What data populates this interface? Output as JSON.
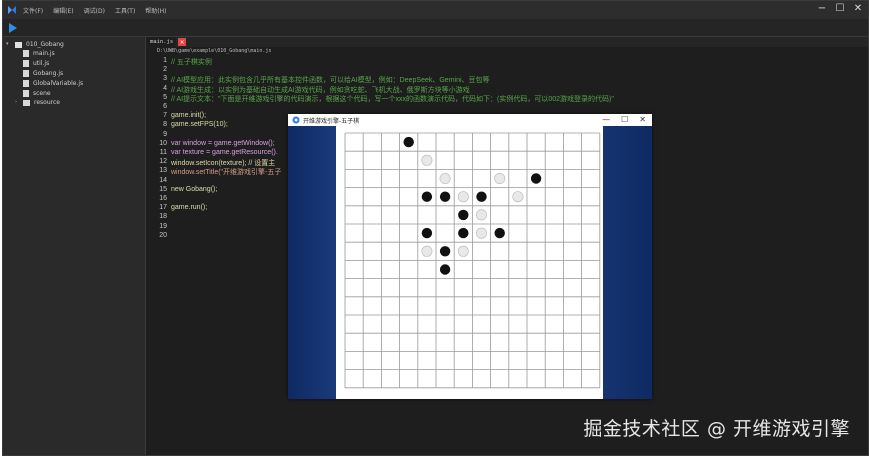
{
  "menu": [
    "文件(F)",
    "编辑(E)",
    "调试(D)",
    "工具(T)",
    "帮助(H)"
  ],
  "window_controls": {
    "minimize": "−",
    "maximize": "☐",
    "close": "✕"
  },
  "explorer": {
    "root": "010_Gobang",
    "items": [
      "main.js",
      "util.js",
      "Gobang.js",
      "GlobalVariable.js",
      "scene",
      "resource"
    ]
  },
  "editor": {
    "tab": "main.js",
    "tab_close": "×",
    "path": "D:\\UWB\\game\\example\\010_Gobang\\main.js",
    "lines": [
      {
        "n": "1",
        "text": "// 五子棋实例",
        "cls": "cmt"
      },
      {
        "n": "2",
        "text": "",
        "cls": "cmt"
      },
      {
        "n": "3",
        "text": "// AI模型应用：此实例包含几乎所有基本控件函数，可以给AI模型，例如：DeepSeek、Gemini、豆包等",
        "cls": "cmt"
      },
      {
        "n": "4",
        "text": "// AI游戏生成：以实例为基础自动生成AI游戏代码，例如贪吃蛇、飞机大战、俄罗斯方块等小游戏",
        "cls": "cmt"
      },
      {
        "n": "5",
        "text": "// AI提示文本：\"下面是开维游戏引擎的代码演示，根据这个代码，写一个xxx的函数演示代码，代码如下：(实例代码，可以002游戏登录的代码)\"",
        "cls": "cmt"
      },
      {
        "n": "6",
        "text": "",
        "cls": "plain"
      },
      {
        "n": "7",
        "text": "game.init();",
        "cls": "fn"
      },
      {
        "n": "8",
        "text": "game.setFPS(10);",
        "cls": "fn"
      },
      {
        "n": "9",
        "text": "",
        "cls": "plain"
      },
      {
        "n": "10",
        "text": "var window = game.getWindow();",
        "cls": "kw"
      },
      {
        "n": "11",
        "text": "var texture = game.getResource().",
        "cls": "kw"
      },
      {
        "n": "12",
        "text": "window.setIcon(texture); // 设置主",
        "cls": "fn"
      },
      {
        "n": "13",
        "text": "window.setTitle(\"开维游戏引擎-五子",
        "cls": "str"
      },
      {
        "n": "14",
        "text": "",
        "cls": "plain"
      },
      {
        "n": "15",
        "text": "new Gobang();",
        "cls": "fn"
      },
      {
        "n": "16",
        "text": "",
        "cls": "plain"
      },
      {
        "n": "17",
        "text": "game.run();",
        "cls": "fn"
      },
      {
        "n": "18",
        "text": "",
        "cls": "plain"
      },
      {
        "n": "19",
        "text": "",
        "cls": "plain"
      },
      {
        "n": "20",
        "text": "",
        "cls": "plain"
      }
    ]
  },
  "game_window": {
    "title": "开维游戏引擎-五子棋",
    "controls": {
      "minimize": "—",
      "maximize": "☐",
      "close": "✕"
    },
    "board": {
      "grid_lines": 15,
      "stones": [
        {
          "col": 4,
          "row": 7,
          "color": "black"
        },
        {
          "col": 5,
          "row": 8,
          "color": "white"
        },
        {
          "col": 6,
          "row": 9,
          "color": "white"
        },
        {
          "col": 9,
          "row": 9,
          "color": "white"
        },
        {
          "col": 11,
          "row": 9,
          "color": "black"
        },
        {
          "col": 5,
          "row": 10,
          "color": "black"
        },
        {
          "col": 6,
          "row": 10,
          "color": "black"
        },
        {
          "col": 7,
          "row": 10,
          "color": "white"
        },
        {
          "col": 8,
          "row": 10,
          "color": "black"
        },
        {
          "col": 10,
          "row": 10,
          "color": "white"
        },
        {
          "col": 7,
          "row": 11,
          "color": "black"
        },
        {
          "col": 8,
          "row": 11,
          "color": "white"
        },
        {
          "col": 5,
          "row": 12,
          "color": "black"
        },
        {
          "col": 7,
          "row": 12,
          "color": "black"
        },
        {
          "col": 8,
          "row": 12,
          "color": "white"
        },
        {
          "col": 9,
          "row": 12,
          "color": "black"
        },
        {
          "col": 5,
          "row": 13,
          "color": "white"
        },
        {
          "col": 6,
          "row": 13,
          "color": "black"
        },
        {
          "col": 7,
          "row": 13,
          "color": "white"
        },
        {
          "col": 6,
          "row": 14,
          "color": "black"
        }
      ]
    }
  },
  "watermark": "掘金技术社区 @ 开维游戏引擎",
  "colors": {
    "accent": "#1e88e5",
    "stone_black": "#111111",
    "stone_white": "#e8e8e8"
  }
}
